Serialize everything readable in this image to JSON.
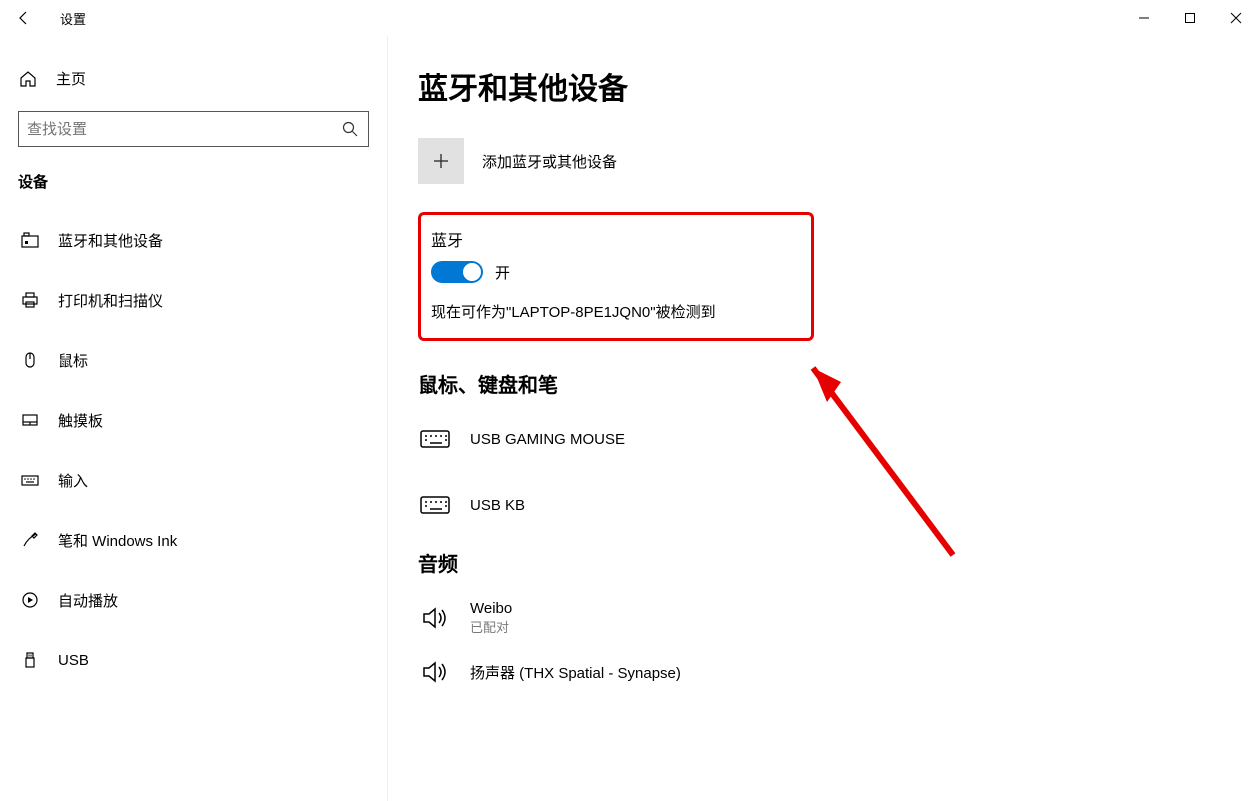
{
  "titlebar": {
    "app_title": "设置"
  },
  "sidebar": {
    "home": "主页",
    "search_placeholder": "查找设置",
    "category": "设备",
    "items": [
      {
        "label": "蓝牙和其他设备"
      },
      {
        "label": "打印机和扫描仪"
      },
      {
        "label": "鼠标"
      },
      {
        "label": "触摸板"
      },
      {
        "label": "输入"
      },
      {
        "label": "笔和 Windows Ink"
      },
      {
        "label": "自动播放"
      },
      {
        "label": "USB"
      }
    ]
  },
  "main": {
    "page_title": "蓝牙和其他设备",
    "add_device": "添加蓝牙或其他设备",
    "bluetooth": {
      "heading": "蓝牙",
      "state_label": "开",
      "status": "现在可作为\"LAPTOP-8PE1JQN0\"被检测到"
    },
    "section_mouse_kb": {
      "heading": "鼠标、键盘和笔",
      "devices": [
        {
          "name": "USB GAMING MOUSE"
        },
        {
          "name": "USB KB"
        }
      ]
    },
    "section_audio": {
      "heading": "音频",
      "devices": [
        {
          "name": "Weibo",
          "sub": "已配对"
        },
        {
          "name": "扬声器 (THX Spatial - Synapse)"
        }
      ]
    }
  }
}
